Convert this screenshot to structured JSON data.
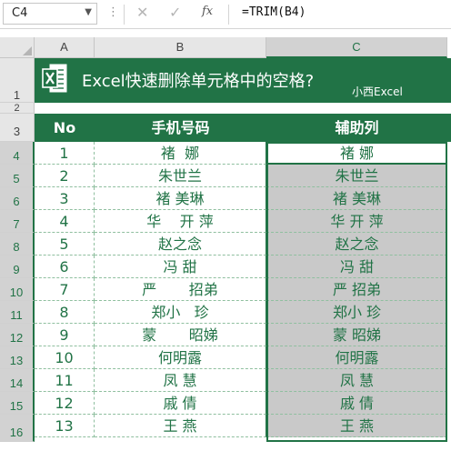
{
  "formula_bar": {
    "name_box": "C4",
    "fx_label": "fx",
    "formula": "=TRIM(B4)"
  },
  "columns": [
    "A",
    "B",
    "C"
  ],
  "rows": [
    "1",
    "2",
    "3",
    "4",
    "5",
    "6",
    "7",
    "8",
    "9",
    "10",
    "11",
    "12",
    "13",
    "14",
    "15",
    "16"
  ],
  "banner": {
    "title": "Excel快速删除单元格中的空格?",
    "brand": "小西Excel"
  },
  "table": {
    "headers": [
      "No",
      "手机号码",
      "辅助列"
    ],
    "rows": [
      {
        "no": "1",
        "phone": "褚  娜",
        "helper": "褚 娜"
      },
      {
        "no": "2",
        "phone": "朱世兰",
        "helper": "朱世兰"
      },
      {
        "no": "3",
        "phone": "褚 美琳",
        "helper": "褚 美琳"
      },
      {
        "no": "4",
        "phone": "华    开 萍",
        "helper": "华 开 萍"
      },
      {
        "no": "5",
        "phone": "赵之念",
        "helper": "赵之念"
      },
      {
        "no": "6",
        "phone": "冯 甜",
        "helper": "冯 甜"
      },
      {
        "no": "7",
        "phone": "严       招弟",
        "helper": "严 招弟"
      },
      {
        "no": "8",
        "phone": "郑小   珍",
        "helper": "郑小 珍"
      },
      {
        "no": "9",
        "phone": "蒙       昭娣",
        "helper": "蒙 昭娣"
      },
      {
        "no": "10",
        "phone": "何明露",
        "helper": "何明露"
      },
      {
        "no": "11",
        "phone": "凤 慧",
        "helper": "凤 慧"
      },
      {
        "no": "12",
        "phone": "戚 倩",
        "helper": "戚 倩"
      },
      {
        "no": "13",
        "phone": "王 燕",
        "helper": "王 燕"
      }
    ]
  },
  "colors": {
    "accent": "#217346",
    "helper_fill": "#c9c9c9"
  }
}
